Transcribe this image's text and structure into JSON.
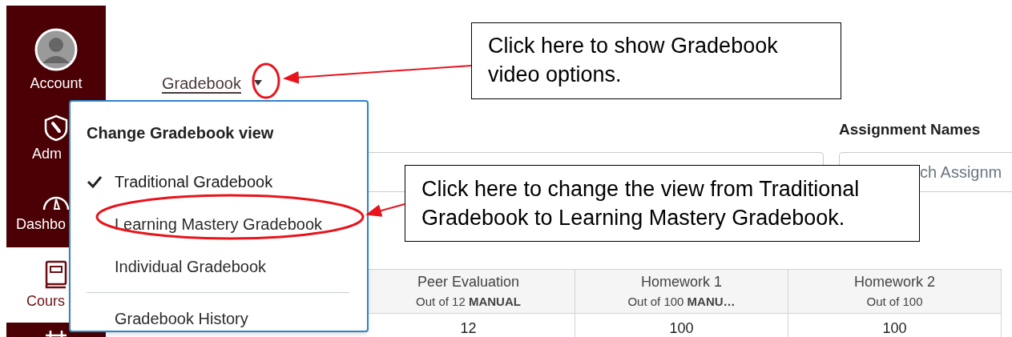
{
  "sidebar": {
    "items": [
      {
        "label": "Account",
        "selected": false
      },
      {
        "label": "Adm",
        "selected": false
      },
      {
        "label": "Dashbo",
        "selected": false
      },
      {
        "label": "Cours",
        "selected": true
      },
      {
        "selected": false
      }
    ]
  },
  "page_title": "Gradebook",
  "view_menu": {
    "title": "Change Gradebook view",
    "sections": [
      [
        {
          "label": "Traditional Gradebook",
          "checked": true
        },
        {
          "label": "Learning Mastery Gradebook",
          "checked": false
        },
        {
          "label": "Individual Gradebook",
          "checked": false
        }
      ],
      [
        {
          "label": "Gradebook History",
          "checked": false
        }
      ]
    ]
  },
  "filters": {
    "assignment_label": "Assignment Names",
    "assignment_search": {
      "placeholder": "ch Assignm"
    }
  },
  "table": {
    "columns": [
      {
        "name": "Peer Evaluation",
        "points": "Out of 12",
        "badge": "MANUAL"
      },
      {
        "name": "Homework 1",
        "points": "Out of 100",
        "badge": "MANU…"
      },
      {
        "name": "Homework 2",
        "points": "Out of 100"
      }
    ],
    "rows": [
      [
        "12",
        "100",
        "100"
      ]
    ]
  },
  "callouts": [
    {
      "text": "Click here to show Gradebook video options."
    },
    {
      "text": "Click here to change the view from Traditional Gradebook to Learning Mastery Gradebook."
    }
  ]
}
